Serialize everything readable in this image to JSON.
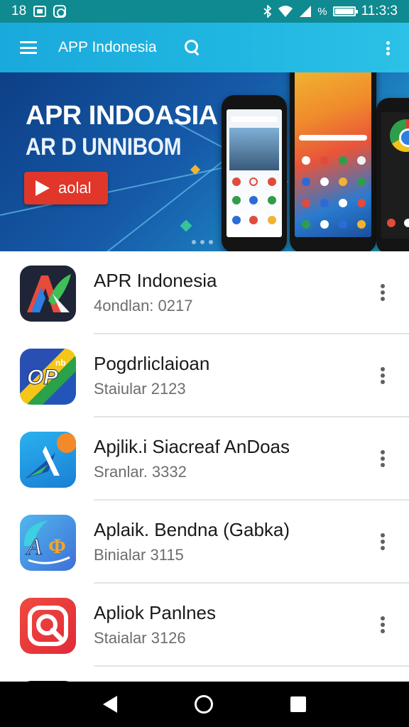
{
  "status_bar": {
    "left_number": "18",
    "time": "11:3:3",
    "percent_symbol": "%"
  },
  "toolbar": {
    "title": "APP Indonesia"
  },
  "banner": {
    "headline": "APR INDOASIA",
    "subheadline": "AR D UNNIBOM",
    "cta_label": "aolal"
  },
  "apps": [
    {
      "title": "APR Indonesia",
      "subtitle": "4ondlan: 0217",
      "icon": "apr-indonesia-logo-icon"
    },
    {
      "title": "Pogdrliclaioan",
      "subtitle": "Staiular 2123",
      "icon": "pogd-logo-icon"
    },
    {
      "title": "Apjlik.i Siacreaf AnDoas",
      "subtitle": "Sranlar. 3332",
      "icon": "arrow-logo-icon"
    },
    {
      "title": "Aplaik. Bendna (Gabka)",
      "subtitle": "Binialar 3115",
      "icon": "acp-logo-icon"
    },
    {
      "title": "Apliok Panlnes",
      "subtitle": "Staialar 3126",
      "icon": "search-camera-logo-icon"
    }
  ],
  "colors": {
    "status_bar": "#0f8a90",
    "toolbar": "#1aa9dc",
    "cta": "#e0372a",
    "nav_bar": "#000000"
  }
}
